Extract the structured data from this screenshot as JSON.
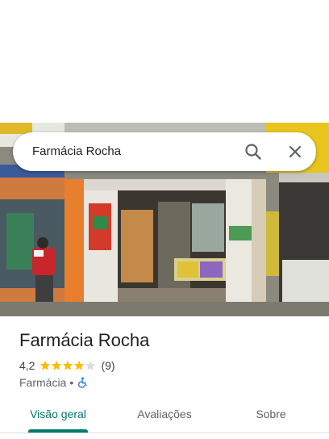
{
  "search": {
    "query": "Farmácia Rocha"
  },
  "place": {
    "name": "Farmácia Rocha",
    "rating": "4,2",
    "stars_filled": 4,
    "stars_total": 5,
    "review_count": "(9)",
    "category": "Farmácia",
    "separator": "•",
    "accessibility_icon": "wheelchair-icon"
  },
  "tabs": [
    {
      "label": "Visão geral",
      "active": true
    },
    {
      "label": "Avaliações",
      "active": false
    },
    {
      "label": "Sobre",
      "active": false
    }
  ],
  "colors": {
    "accent": "#00796b",
    "star": "#fbbc04",
    "star_empty": "#dadce0",
    "access_blue": "#1a73e8"
  }
}
